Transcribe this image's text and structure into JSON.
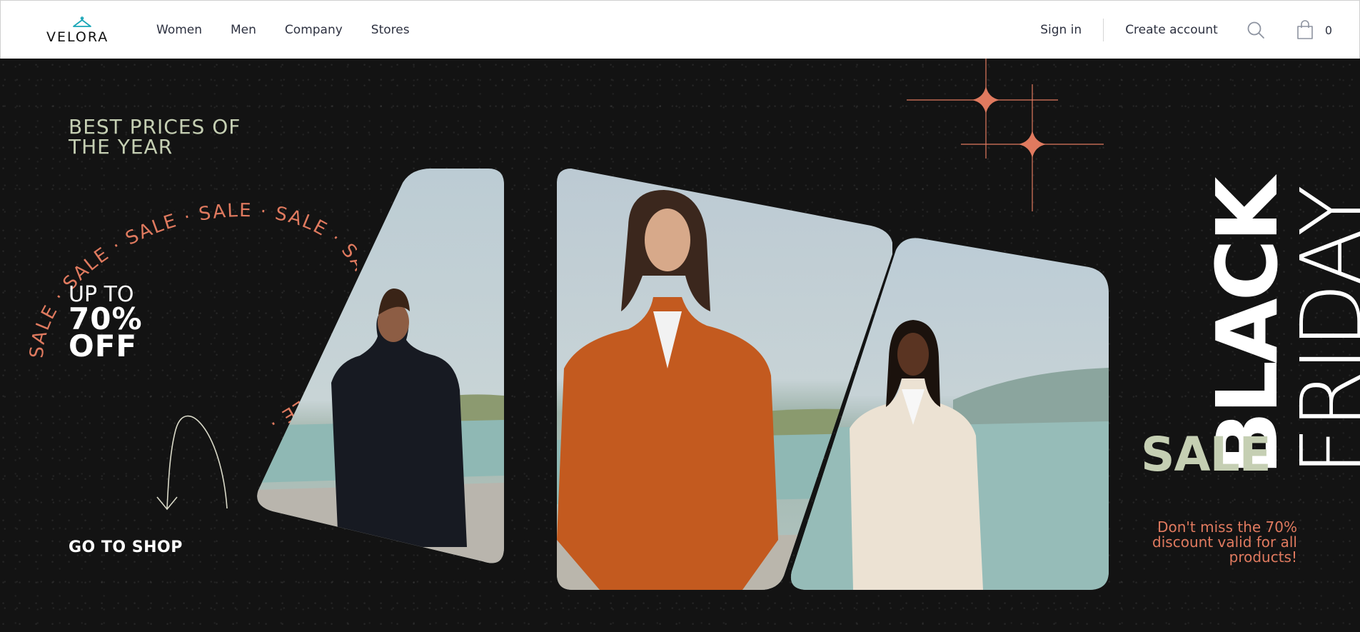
{
  "header": {
    "brand": "VELORA",
    "nav": [
      "Women",
      "Men",
      "Company",
      "Stores"
    ],
    "sign_in": "Sign in",
    "create_account": "Create account",
    "cart_count": "0"
  },
  "hero": {
    "best_prices": "BEST PRICES OF THE YEAR",
    "up_to": "UP TO",
    "discount": "70% OFF",
    "sale_ring_text": "SALE · SALE · SALE · SALE · SALE · SALE · SALE · SALE ·",
    "cta": "GO TO SHOP",
    "title_line1": "BLACK",
    "title_line2": "FRIDAY",
    "title_line3": "SALE",
    "promo": "Don't miss the 70% discount valid for all products!"
  },
  "colors": {
    "accent": "#e07a5f",
    "sage": "#c5cfb3",
    "background": "#131313",
    "header_text": "#2d3140"
  },
  "icons": [
    "hanger-logo-icon",
    "search-icon",
    "shopping-bag-icon",
    "sparkle-icon",
    "curved-arrow-icon"
  ]
}
